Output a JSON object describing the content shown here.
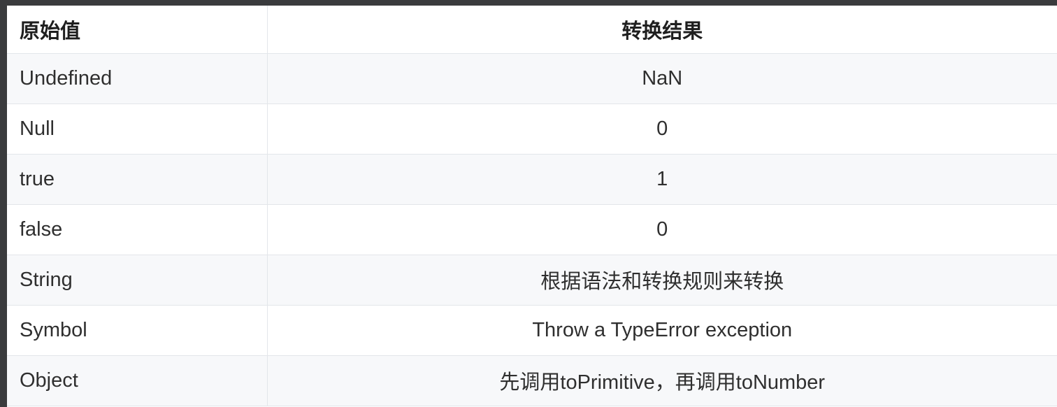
{
  "table": {
    "headers": [
      "原始值",
      "转换结果"
    ],
    "rows": [
      [
        "Undefined",
        "NaN"
      ],
      [
        "Null",
        "0"
      ],
      [
        "true",
        "1"
      ],
      [
        "false",
        "0"
      ],
      [
        "String",
        "根据语法和转换规则来转换"
      ],
      [
        "Symbol",
        "Throw a TypeError exception"
      ],
      [
        "Object",
        "先调用toPrimitive，再调用toNumber"
      ]
    ]
  },
  "colors": {
    "frame": "#3a3b3d",
    "row_stripe": "#f7f8fa",
    "row_base": "#ffffff",
    "border": "#e3e6ea",
    "text": "#2f2f2f"
  }
}
